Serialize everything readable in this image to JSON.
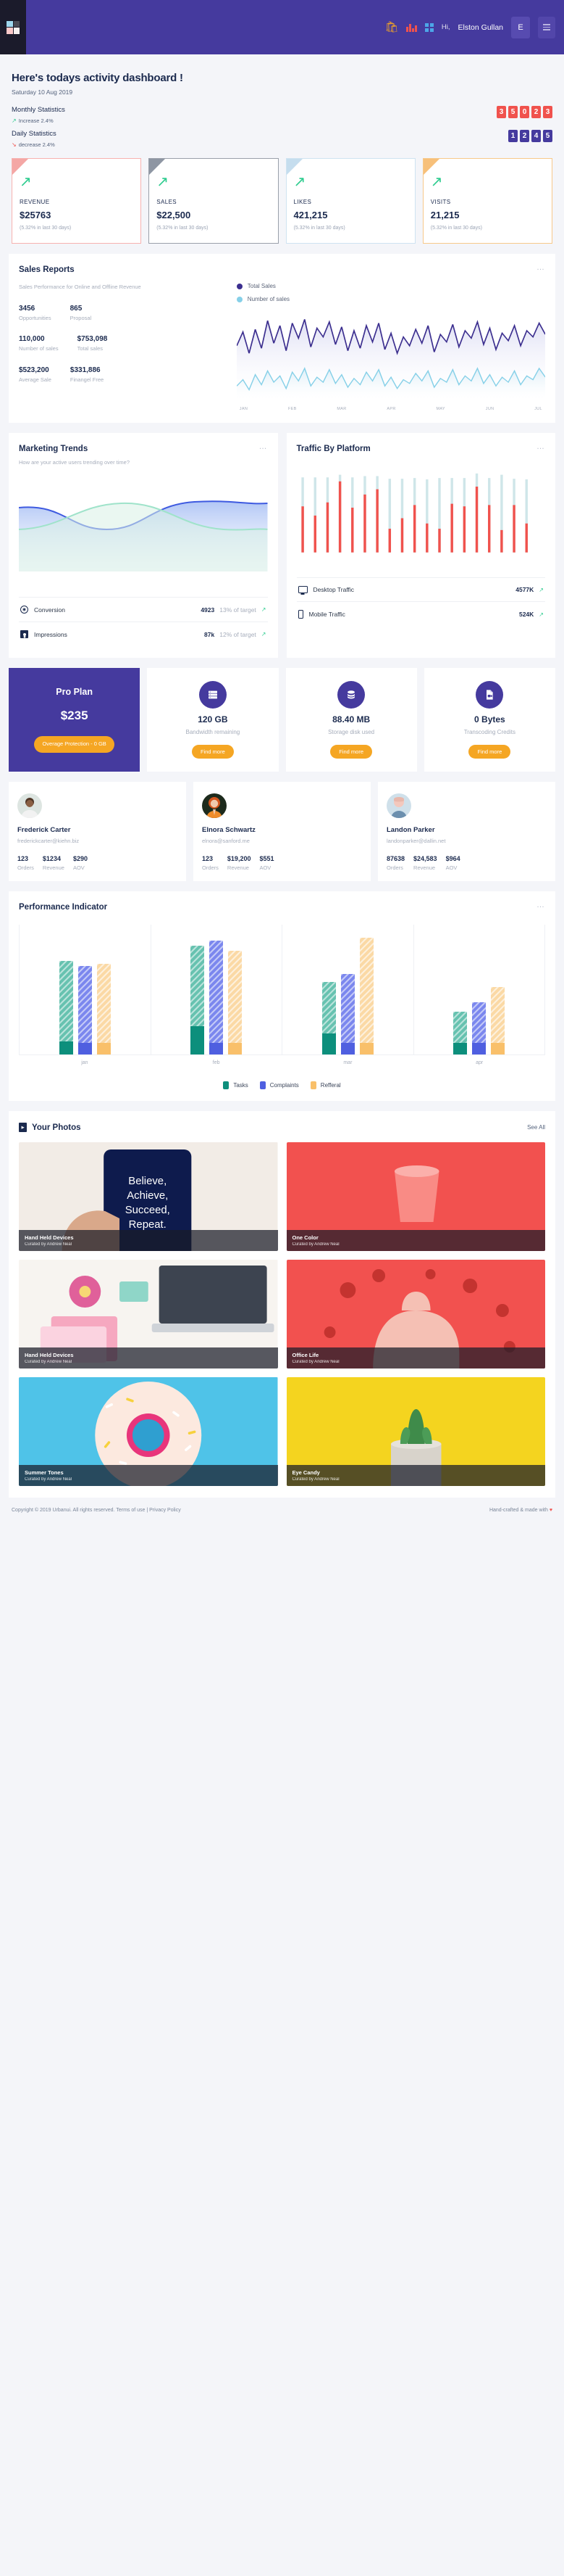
{
  "topbar": {
    "logo_name": "app-logo",
    "icons": [
      "basket-icon",
      "bar-chart-icon",
      "grid-icon"
    ],
    "greeting": "Hi,",
    "username": "Elston Gullan",
    "avatar_initial": "E",
    "menu_label": "menu-icon"
  },
  "page_head": {
    "title": "Here's todays activity dashboard !",
    "date": "Saturday 10 Aug 2019",
    "monthly": {
      "label": "Monthly Statistics",
      "delta": "Increase 2.4%",
      "direction": "up",
      "digits": [
        "3",
        "5",
        "0",
        "2",
        "3"
      ]
    },
    "daily": {
      "label": "Daily Statistics",
      "delta": "decrease 2.4%",
      "direction": "down",
      "digits": [
        "1",
        "2",
        "4",
        "5"
      ]
    }
  },
  "kpis": [
    {
      "name": "REVENUE",
      "value": "$25763",
      "sub": "(5.32% in last 30 days)",
      "color": "#f4a7a5"
    },
    {
      "name": "SALES",
      "value": "$22,500",
      "sub": "(5.32% in last 30 days)",
      "color": "#8e96a3"
    },
    {
      "name": "LIKES",
      "value": "421,215",
      "sub": "(5.32% in last 30 days)",
      "color": "#c5ddee"
    },
    {
      "name": "VISITS",
      "value": "21,215",
      "sub": "(5.32% in last 30 days)",
      "color": "#f7c07a"
    }
  ],
  "sales_reports": {
    "title": "Sales Reports",
    "subtitle": "Sales Performance for Online and Offline Revenue",
    "stats": [
      {
        "num": "3456",
        "cap": "Opportunities"
      },
      {
        "num": "865",
        "cap": "Proposal"
      },
      {
        "num": "110,000",
        "cap": "Number of sales"
      },
      {
        "num": "$753,098",
        "cap": "Total sales"
      },
      {
        "num": "$523,200",
        "cap": "Average Sale"
      },
      {
        "num": "$331,886",
        "cap": "Finangel Free"
      }
    ],
    "legend": [
      {
        "label": "Total Sales",
        "color": "#3c2f8f"
      },
      {
        "label": "Number of sales",
        "color": "#86d0e8"
      }
    ],
    "menu": "…"
  },
  "chart_data": [
    {
      "type": "line",
      "title": "Sales Reports",
      "xlabel": "",
      "ylabel": "",
      "categories": [
        "JAN",
        "FEB",
        "MAR",
        "APR",
        "MAY",
        "JUN",
        "JUL"
      ],
      "series": [
        {
          "name": "Total Sales",
          "color": "#3c2f8f",
          "values": [
            62,
            70,
            48,
            66,
            55,
            74,
            61,
            80,
            58,
            72,
            64,
            85,
            70,
            92,
            76,
            88,
            79,
            95,
            83,
            90,
            86,
            99,
            91,
            96
          ]
        },
        {
          "name": "Number of sales",
          "color": "#86d0e8",
          "values": [
            20,
            26,
            18,
            30,
            22,
            35,
            27,
            40,
            31,
            44,
            36,
            50,
            41,
            55,
            46,
            58,
            49,
            62,
            52,
            57,
            54,
            64,
            59,
            61
          ]
        }
      ],
      "ylim": [
        0,
        100
      ],
      "grid": false,
      "legend_position": "top-right"
    },
    {
      "type": "area",
      "title": "Marketing Trends",
      "subtitle": "How are your active users trending over time?",
      "categories": [
        "1",
        "2",
        "3",
        "4",
        "5",
        "6",
        "7",
        "8"
      ],
      "series": [
        {
          "name": "users-wave-blue",
          "color": "#3e5ae0",
          "values": [
            72,
            64,
            56,
            50,
            48,
            55,
            66,
            74,
            76
          ]
        },
        {
          "name": "users-wave-green",
          "color": "#9fe3ca",
          "values": [
            50,
            58,
            68,
            76,
            74,
            64,
            54,
            48,
            50
          ]
        }
      ],
      "ylim": [
        0,
        100
      ],
      "grid": false
    },
    {
      "type": "bar",
      "title": "Traffic By Platform",
      "categories": [
        "1",
        "2",
        "3",
        "4",
        "5",
        "6",
        "7",
        "8",
        "9",
        "10",
        "11",
        "12",
        "13",
        "14",
        "15",
        "16",
        "17",
        "18",
        "19",
        "20"
      ],
      "series": [
        {
          "name": "red-segment",
          "color": "#f0524d",
          "values": [
            52,
            38,
            58,
            74,
            50,
            68,
            72,
            24,
            42,
            56,
            32,
            30,
            54,
            50,
            70,
            34,
            52,
            44,
            28,
            46
          ]
        },
        {
          "name": "teal-segment",
          "color": "#b9dde0",
          "values": [
            30,
            40,
            26,
            14,
            32,
            20,
            14,
            58,
            44,
            30,
            50,
            52,
            28,
            36,
            18,
            60,
            30,
            38,
            54,
            36
          ]
        }
      ],
      "ylim": [
        0,
        100
      ],
      "grid": false
    },
    {
      "type": "bar",
      "title": "Performance Indicator",
      "categories": [
        "jan",
        "feb",
        "mar",
        "apr"
      ],
      "series": [
        {
          "name": "Tasks",
          "color": "#0d8f7c",
          "values": [
            72,
            84,
            56,
            42
          ]
        },
        {
          "name": "Complaints",
          "color": "#4f5fe0",
          "values": [
            68,
            88,
            62,
            40
          ]
        },
        {
          "name": "Refferal",
          "color": "#f9c06a",
          "values": [
            70,
            80,
            90,
            52
          ]
        }
      ],
      "ylim": [
        0,
        100
      ],
      "grid": true,
      "legend_position": "bottom-center"
    }
  ],
  "marketing_trends": {
    "title": "Marketing Trends",
    "subtitle": "How are your active users trending over time?",
    "menu": "…",
    "metrics": [
      {
        "icon": "chrome-icon",
        "label": "Conversion",
        "value": "4923",
        "pct": "13% of target"
      },
      {
        "icon": "person-icon",
        "label": "Impressions",
        "value": "87k",
        "pct": "12% of target"
      }
    ]
  },
  "traffic_platform": {
    "title": "Traffic By Platform",
    "menu": "…",
    "metrics": [
      {
        "icon": "monitor-icon",
        "label": "Desktop Traffic",
        "value": "4577K"
      },
      {
        "icon": "phone-icon",
        "label": "Mobile Traffic",
        "value": "524K"
      }
    ]
  },
  "plans": {
    "pro": {
      "name": "Pro Plan",
      "price": "$235",
      "button": "Overage Protection - 0 GB"
    },
    "cards": [
      {
        "icon": "server-icon",
        "value": "120 GB",
        "caption": "Bandwidth remaining",
        "button": "Find more"
      },
      {
        "icon": "database-icon",
        "value": "88.40 MB",
        "caption": "Storage disk used",
        "button": "Find more"
      },
      {
        "icon": "video-file-icon",
        "value": "0 Bytes",
        "caption": "Transcoding Credits",
        "button": "Find more"
      }
    ]
  },
  "people": {
    "columns": [
      "Orders",
      "Revenue",
      "AOV"
    ],
    "items": [
      {
        "name": "Frederick Carter",
        "email": "frederickcarter@kiehn.biz",
        "orders": "123",
        "revenue": "$1234",
        "aov": "$290"
      },
      {
        "name": "Elnora Schwartz",
        "email": "elnora@sanford.me",
        "orders": "123",
        "revenue": "$19,200",
        "aov": "$551"
      },
      {
        "name": "Landon Parker",
        "email": "landonparker@dallin.net",
        "orders": "87638",
        "revenue": "$24,583",
        "aov": "$964"
      }
    ]
  },
  "performance": {
    "title": "Performance Indicator",
    "menu": "…",
    "months": [
      "jan",
      "feb",
      "mar",
      "apr"
    ],
    "legend": [
      {
        "label": "Tasks",
        "color": "#0d8f7c"
      },
      {
        "label": "Complaints",
        "color": "#4f5fe0"
      },
      {
        "label": "Refferal",
        "color": "#f9c06a"
      }
    ]
  },
  "photos": {
    "title": "Your Photos",
    "see_all": "See All",
    "items": [
      {
        "title": "Hand Held Devices",
        "sub": "Curated by Andrew Neal"
      },
      {
        "title": "One Color",
        "sub": "Curated by Andrew Neal"
      },
      {
        "title": "Hand Held Devices",
        "sub": "Curated by Andrew Neal"
      },
      {
        "title": "Office Life",
        "sub": "Curated by Andrew Neal"
      },
      {
        "title": "Summer Tones",
        "sub": "Curated by Andrew Neal"
      },
      {
        "title": "Eye Candy",
        "sub": "Curated by Andrew Neal"
      }
    ]
  },
  "footer": {
    "copyright": "Copyright © 2019 Urbanui. All rights reserved.",
    "terms": "Terms of use",
    "divider": "|",
    "privacy": "Privacy Policy",
    "credit_pre": "Hand-crafted & made with ",
    "credit_post": ""
  }
}
